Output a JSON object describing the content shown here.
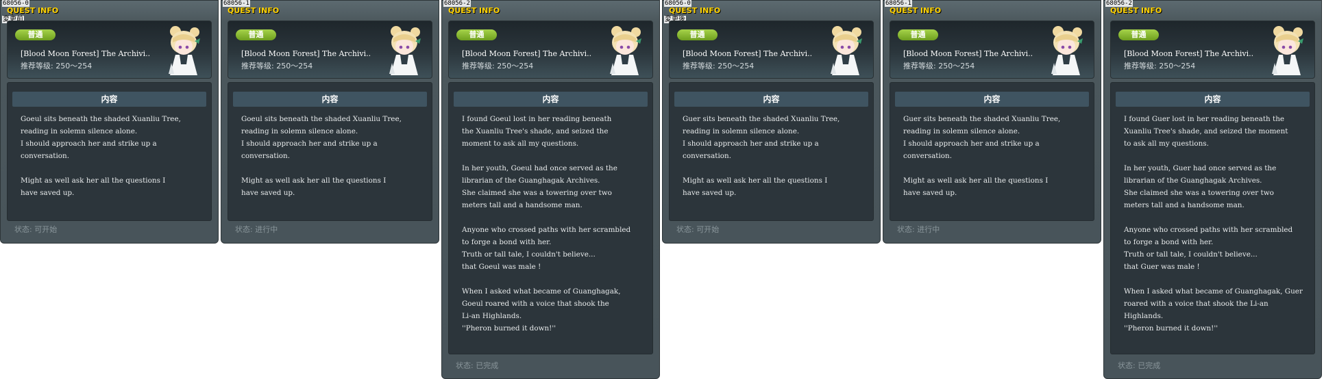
{
  "common": {
    "quest_info_label": "QUEST INFO",
    "grade_badge": "普通",
    "content_title": "内容",
    "portrait_icon": "npc-portrait-icon"
  },
  "panels": [
    {
      "id": "68056-0",
      "note": "変更前",
      "title": "[Blood Moon Forest] The Archivi..",
      "level": "推荐等级: 250～254",
      "lines": [
        "Goeul sits beneath the shaded Xuanliu Tree,",
        "reading in solemn silence alone.",
        "I should approach her and strike up a",
        "conversation.",
        "",
        "Might as well ask her all the questions I",
        "have saved up."
      ],
      "status": "状态: 可开始"
    },
    {
      "id": "68056-1",
      "note": "",
      "title": "[Blood Moon Forest] The Archivi..",
      "level": "推荐等级: 250～254",
      "lines": [
        "Goeul sits beneath the shaded Xuanliu Tree,",
        "reading in solemn silence alone.",
        "I should approach her and strike up a",
        "conversation.",
        "",
        "Might as well ask her all the questions I",
        "have saved up."
      ],
      "status": "状态: 进行中"
    },
    {
      "id": "68056-2",
      "note": "",
      "title": "[Blood Moon Forest] The Archivi..",
      "level": "推荐等级: 250～254",
      "lines": [
        "I found Goeul lost in her reading beneath",
        "the Xuanliu Tree's shade, and seized the",
        "moment to ask all my questions.",
        "",
        "In her youth, Goeul had once served as the",
        "librarian of the Guanghagak Archives.",
        "She claimed she was a towering over two",
        "meters tall and a handsome man.",
        "",
        "Anyone who crossed paths with her scrambled",
        "to forge a bond with her.",
        "Truth or tall tale, I couldn't believe...",
        "that Goeul was male !",
        "",
        "When I asked what became of Guanghagak,",
        "Goeul roared with a voice that shook the",
        "Li-an Highlands.",
        "''Pheron burned it down!''"
      ],
      "status": "状态: 已完成"
    },
    {
      "id": "68056-0",
      "note": "変更後",
      "title": "[Blood Moon Forest] The Archivi..",
      "level": "推荐等级: 250～254",
      "lines": [
        "Guer sits beneath the shaded Xuanliu Tree,",
        "reading in solemn silence alone.",
        "I should approach her and strike up a",
        "conversation.",
        "",
        "Might as well ask her all the questions I",
        "have saved up."
      ],
      "status": "状态: 可开始"
    },
    {
      "id": "68056-1",
      "note": "",
      "title": "[Blood Moon Forest] The Archivi..",
      "level": "推荐等级: 250～254",
      "lines": [
        "Guer sits beneath the shaded Xuanliu Tree,",
        "reading in solemn silence alone.",
        "I should approach her and strike up a",
        "conversation.",
        "",
        "Might as well ask her all the questions I",
        "have saved up."
      ],
      "status": "状态: 进行中"
    },
    {
      "id": "68056-2",
      "note": "",
      "title": "[Blood Moon Forest] The Archivi..",
      "level": "推荐等级: 250～254",
      "lines": [
        "I found Guer lost in her reading beneath the",
        "Xuanliu Tree's shade, and seized the moment",
        "to ask all my questions.",
        "",
        "In her youth, Guer had once served as the",
        "librarian of the Guanghagak Archives.",
        "She claimed she was a towering over two",
        "meters tall and a handsome man.",
        "",
        "Anyone who crossed paths with her scrambled",
        "to forge a bond with her.",
        "Truth or tall tale, I couldn't believe...",
        "that Guer was male !",
        "",
        "When I asked what became of Guanghagak, Guer",
        "roared with a voice that shook the Li-an",
        "Highlands.",
        "''Pheron burned it down!''"
      ],
      "status": "状态: 已完成"
    }
  ]
}
